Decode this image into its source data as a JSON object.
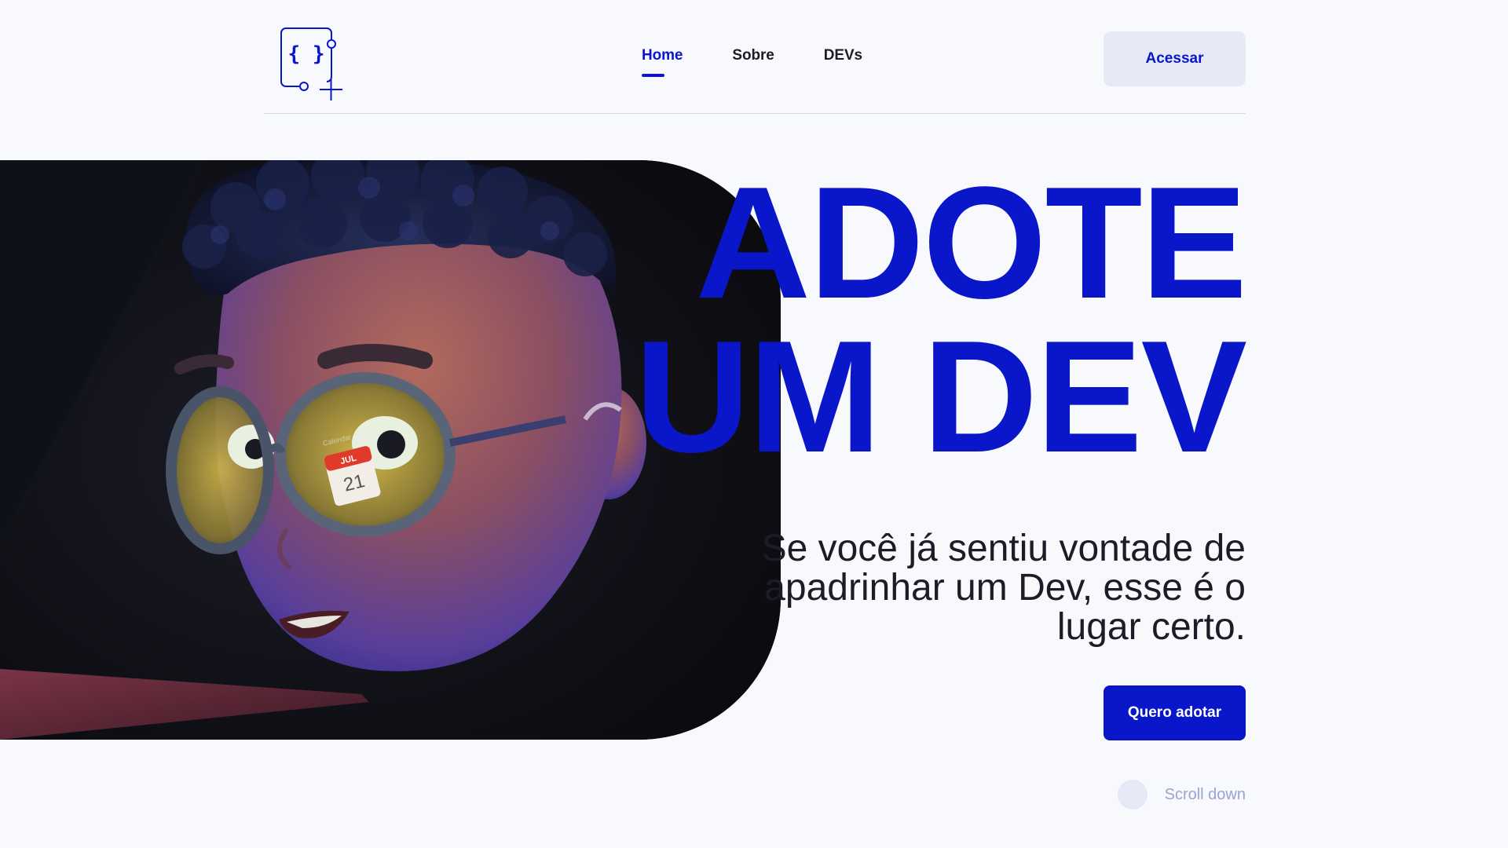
{
  "brand": {
    "logo_icon": "code-braces-logo-icon",
    "logo_glyph": "{ }",
    "accent_color": "#0a16c9"
  },
  "nav": {
    "items": [
      {
        "label": "Home",
        "active": true
      },
      {
        "label": "Sobre",
        "active": false
      },
      {
        "label": "DEVs",
        "active": false
      }
    ]
  },
  "header": {
    "access_label": "Acessar"
  },
  "hero": {
    "headline_line1": "ADOTE",
    "headline_line2": "UM DEV",
    "subtitle": "Se você já sentiu vontade de apadrinhar um Dev, esse é o lugar certo.",
    "cta_label": "Quero adotar",
    "scroll_label": "Scroll down",
    "image_subject": "3d-avatar-with-glasses-image",
    "glasses_reflection_label": "Calendar",
    "glasses_reflection_month": "JUL",
    "glasses_reflection_day": "21"
  }
}
